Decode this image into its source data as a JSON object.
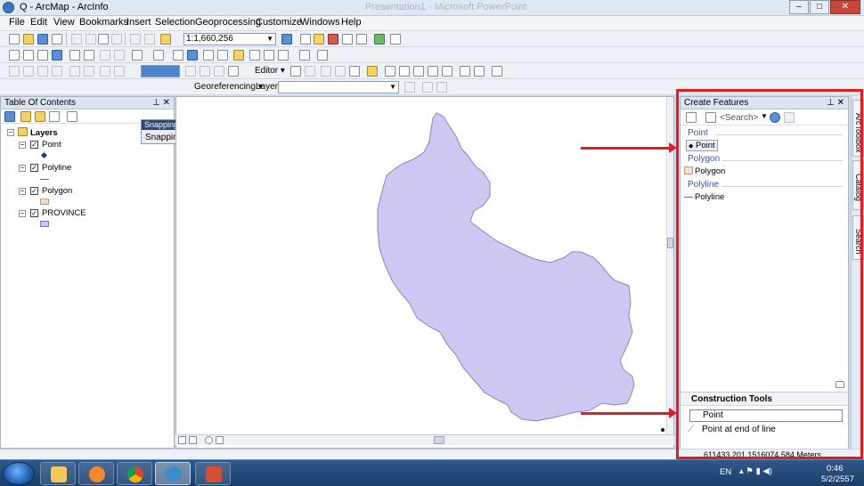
{
  "window": {
    "title": "Q - ArcMap - ArcInfo",
    "ghost_title": "Presentation1 - Microsoft PowerPoint",
    "controls": [
      "–",
      "□",
      "✕"
    ]
  },
  "menu": [
    "File",
    "Edit",
    "View",
    "Bookmarks",
    "Insert",
    "Selection",
    "Geoprocessing",
    "Customize",
    "Windows",
    "Help"
  ],
  "standard_toolbar": {
    "scale": "1:1,660,256"
  },
  "editor_toolbar": {
    "editor_label": "Editor ▾"
  },
  "georef_toolbar": {
    "georeferencing_label": "Georeferencing ▾",
    "layer_label": "Layer:"
  },
  "toc": {
    "title": "Table Of Contents",
    "root": "Layers",
    "layers": [
      {
        "name": "Point",
        "symbol": "point"
      },
      {
        "name": "Polyline",
        "symbol": "line"
      },
      {
        "name": "Polygon",
        "symbol": "polygon-tan"
      },
      {
        "name": "PROVINCE",
        "symbol": "polygon-purple"
      }
    ]
  },
  "snapping": {
    "title": "Snapping",
    "menu_label": "Snapping ▾"
  },
  "create_features": {
    "title": "Create Features",
    "search_placeholder": "<Search>",
    "groups": [
      {
        "name": "Point",
        "template": "Point",
        "selected": true
      },
      {
        "name": "Polygon",
        "template": "Polygon",
        "selected": false
      },
      {
        "name": "Polyline",
        "template": "Polyline",
        "selected": false
      }
    ]
  },
  "construction_tools": {
    "title": "Construction Tools",
    "items": [
      {
        "label": "Point",
        "selected": true
      },
      {
        "label": "Point at end of line",
        "selected": false
      }
    ]
  },
  "side_tabs": [
    "ArcToolbox",
    "Catalog",
    "Search"
  ],
  "status": {
    "coordinates": "611433.201 1516074.584 Meters"
  },
  "taskbar": {
    "apps": [
      "explorer",
      "media-player",
      "chrome",
      "arcmap",
      "powerpoint"
    ],
    "language": "EN",
    "time": "0:46",
    "date": "5/2/2557"
  },
  "colors": {
    "province_fill": "#cdc8f2",
    "province_stroke": "#8a82c2",
    "highlight_red": "#e31b23",
    "group_blue": "#2f5aa8"
  }
}
